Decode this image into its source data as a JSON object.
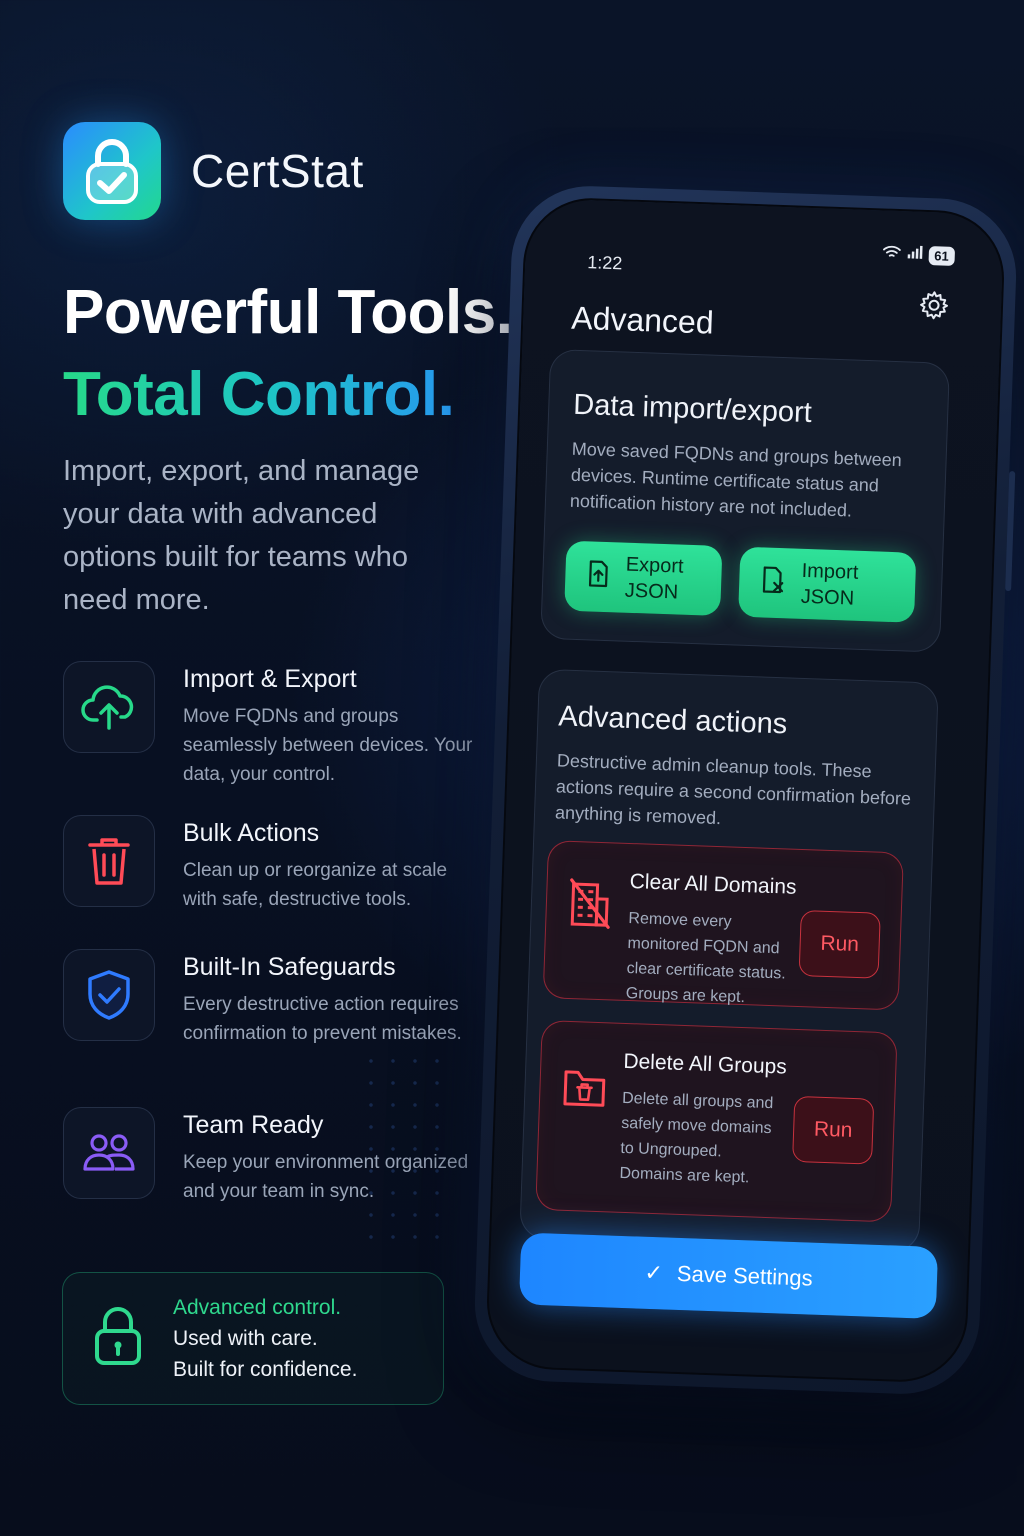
{
  "brand": {
    "name": "CertStat",
    "icon": "lock-check-icon"
  },
  "headline": {
    "line1": "Powerful Tools.",
    "line2": "Total Control."
  },
  "subhead": "Import, export, and manage your data with advanced options built for teams who need more.",
  "features": [
    {
      "icon": "cloud-upload-icon",
      "title": "Import & Export",
      "desc": "Move FQDNs and groups seamlessly between devices. Your data, your control."
    },
    {
      "icon": "trash-icon",
      "title": "Bulk Actions",
      "desc": "Clean up or reorganize at scale with safe, destructive tools."
    },
    {
      "icon": "shield-check-icon",
      "title": "Built-In Safeguards",
      "desc": "Every destructive action requires confirmation to prevent mistakes."
    },
    {
      "icon": "team-icon",
      "title": "Team Ready",
      "desc": "Keep your environment organized and your team in sync."
    }
  ],
  "callout": {
    "line1": "Advanced control.",
    "line2": "Used with care.",
    "line3": "Built for confidence."
  },
  "phone": {
    "time": "1:22",
    "battery": "61",
    "title": "Advanced",
    "import_export": {
      "title": "Data import/export",
      "desc": "Move saved FQDNs and groups between devices. Runtime certificate status and notification history are not included.",
      "export_label": "Export JSON",
      "import_label": "Import JSON"
    },
    "advanced": {
      "title": "Advanced actions",
      "desc": "Destructive admin cleanup tools. These actions require a second confirmation before anything is removed.",
      "clear": {
        "title": "Clear All Domains",
        "desc": "Remove every monitored FQDN and clear certificate status. Groups are kept.",
        "run": "Run"
      },
      "delete": {
        "title": "Delete All Groups",
        "desc": "Delete all groups and safely move domains to Ungrouped. Domains are kept.",
        "run": "Run"
      }
    },
    "save_label": "Save Settings"
  },
  "colors": {
    "accent_green": "#27d98a",
    "accent_blue": "#2a8cff",
    "danger": "#e03a46",
    "purple": "#8a5cf6"
  }
}
